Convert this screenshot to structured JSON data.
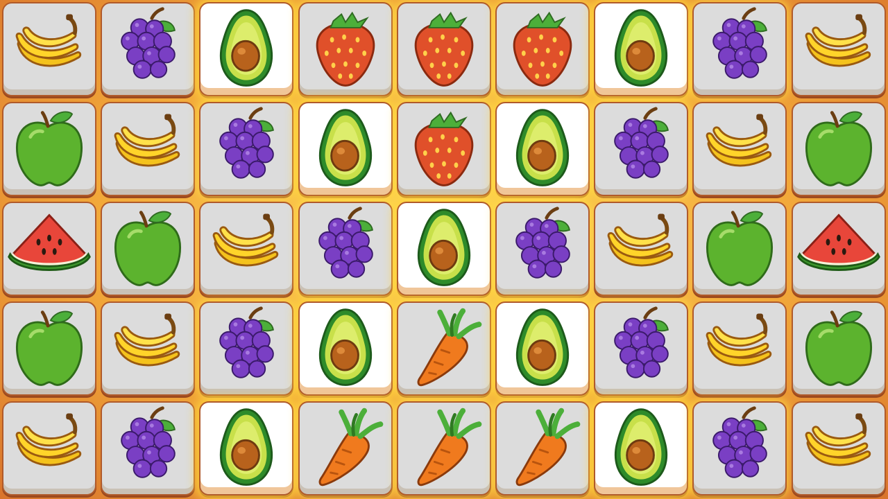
{
  "board": {
    "rows": [
      [
        {
          "fruit": "banana",
          "state": "normal"
        },
        {
          "fruit": "grapes",
          "state": "normal"
        },
        {
          "fruit": "avocado",
          "state": "highlighted"
        },
        {
          "fruit": "strawberry",
          "state": "glow"
        },
        {
          "fruit": "strawberry",
          "state": "glow"
        },
        {
          "fruit": "strawberry",
          "state": "glow"
        },
        {
          "fruit": "avocado",
          "state": "highlighted"
        },
        {
          "fruit": "grapes",
          "state": "glow"
        },
        {
          "fruit": "banana",
          "state": "normal"
        }
      ],
      [
        {
          "fruit": "apple",
          "state": "normal"
        },
        {
          "fruit": "banana",
          "state": "normal"
        },
        {
          "fruit": "grapes",
          "state": "glow"
        },
        {
          "fruit": "avocado",
          "state": "highlighted"
        },
        {
          "fruit": "strawberry",
          "state": "glow"
        },
        {
          "fruit": "avocado",
          "state": "highlighted"
        },
        {
          "fruit": "grapes",
          "state": "glow"
        },
        {
          "fruit": "banana",
          "state": "normal"
        },
        {
          "fruit": "apple",
          "state": "normal"
        }
      ],
      [
        {
          "fruit": "watermelon",
          "state": "normal"
        },
        {
          "fruit": "apple",
          "state": "normal"
        },
        {
          "fruit": "banana",
          "state": "normal"
        },
        {
          "fruit": "grapes",
          "state": "glow"
        },
        {
          "fruit": "avocado",
          "state": "highlighted"
        },
        {
          "fruit": "grapes",
          "state": "glow"
        },
        {
          "fruit": "banana",
          "state": "normal"
        },
        {
          "fruit": "apple",
          "state": "normal"
        },
        {
          "fruit": "watermelon",
          "state": "normal"
        }
      ],
      [
        {
          "fruit": "apple",
          "state": "normal"
        },
        {
          "fruit": "banana",
          "state": "normal"
        },
        {
          "fruit": "grapes",
          "state": "glow"
        },
        {
          "fruit": "avocado",
          "state": "highlighted"
        },
        {
          "fruit": "carrot",
          "state": "glow"
        },
        {
          "fruit": "avocado",
          "state": "highlighted"
        },
        {
          "fruit": "grapes",
          "state": "glow"
        },
        {
          "fruit": "banana",
          "state": "normal"
        },
        {
          "fruit": "apple",
          "state": "normal"
        }
      ],
      [
        {
          "fruit": "banana",
          "state": "normal"
        },
        {
          "fruit": "grapes",
          "state": "normal"
        },
        {
          "fruit": "avocado",
          "state": "highlighted"
        },
        {
          "fruit": "carrot",
          "state": "glow"
        },
        {
          "fruit": "carrot",
          "state": "glow"
        },
        {
          "fruit": "carrot",
          "state": "glow"
        },
        {
          "fruit": "avocado",
          "state": "highlighted"
        },
        {
          "fruit": "grapes",
          "state": "glow"
        },
        {
          "fruit": "banana",
          "state": "normal"
        }
      ]
    ]
  },
  "colors": {
    "board_background": "#f2a93a",
    "tile_normal": "#dcdcdc",
    "tile_highlighted": "#ffffff",
    "tile_border": "#b05a2a",
    "glow": "#ffd73c"
  }
}
